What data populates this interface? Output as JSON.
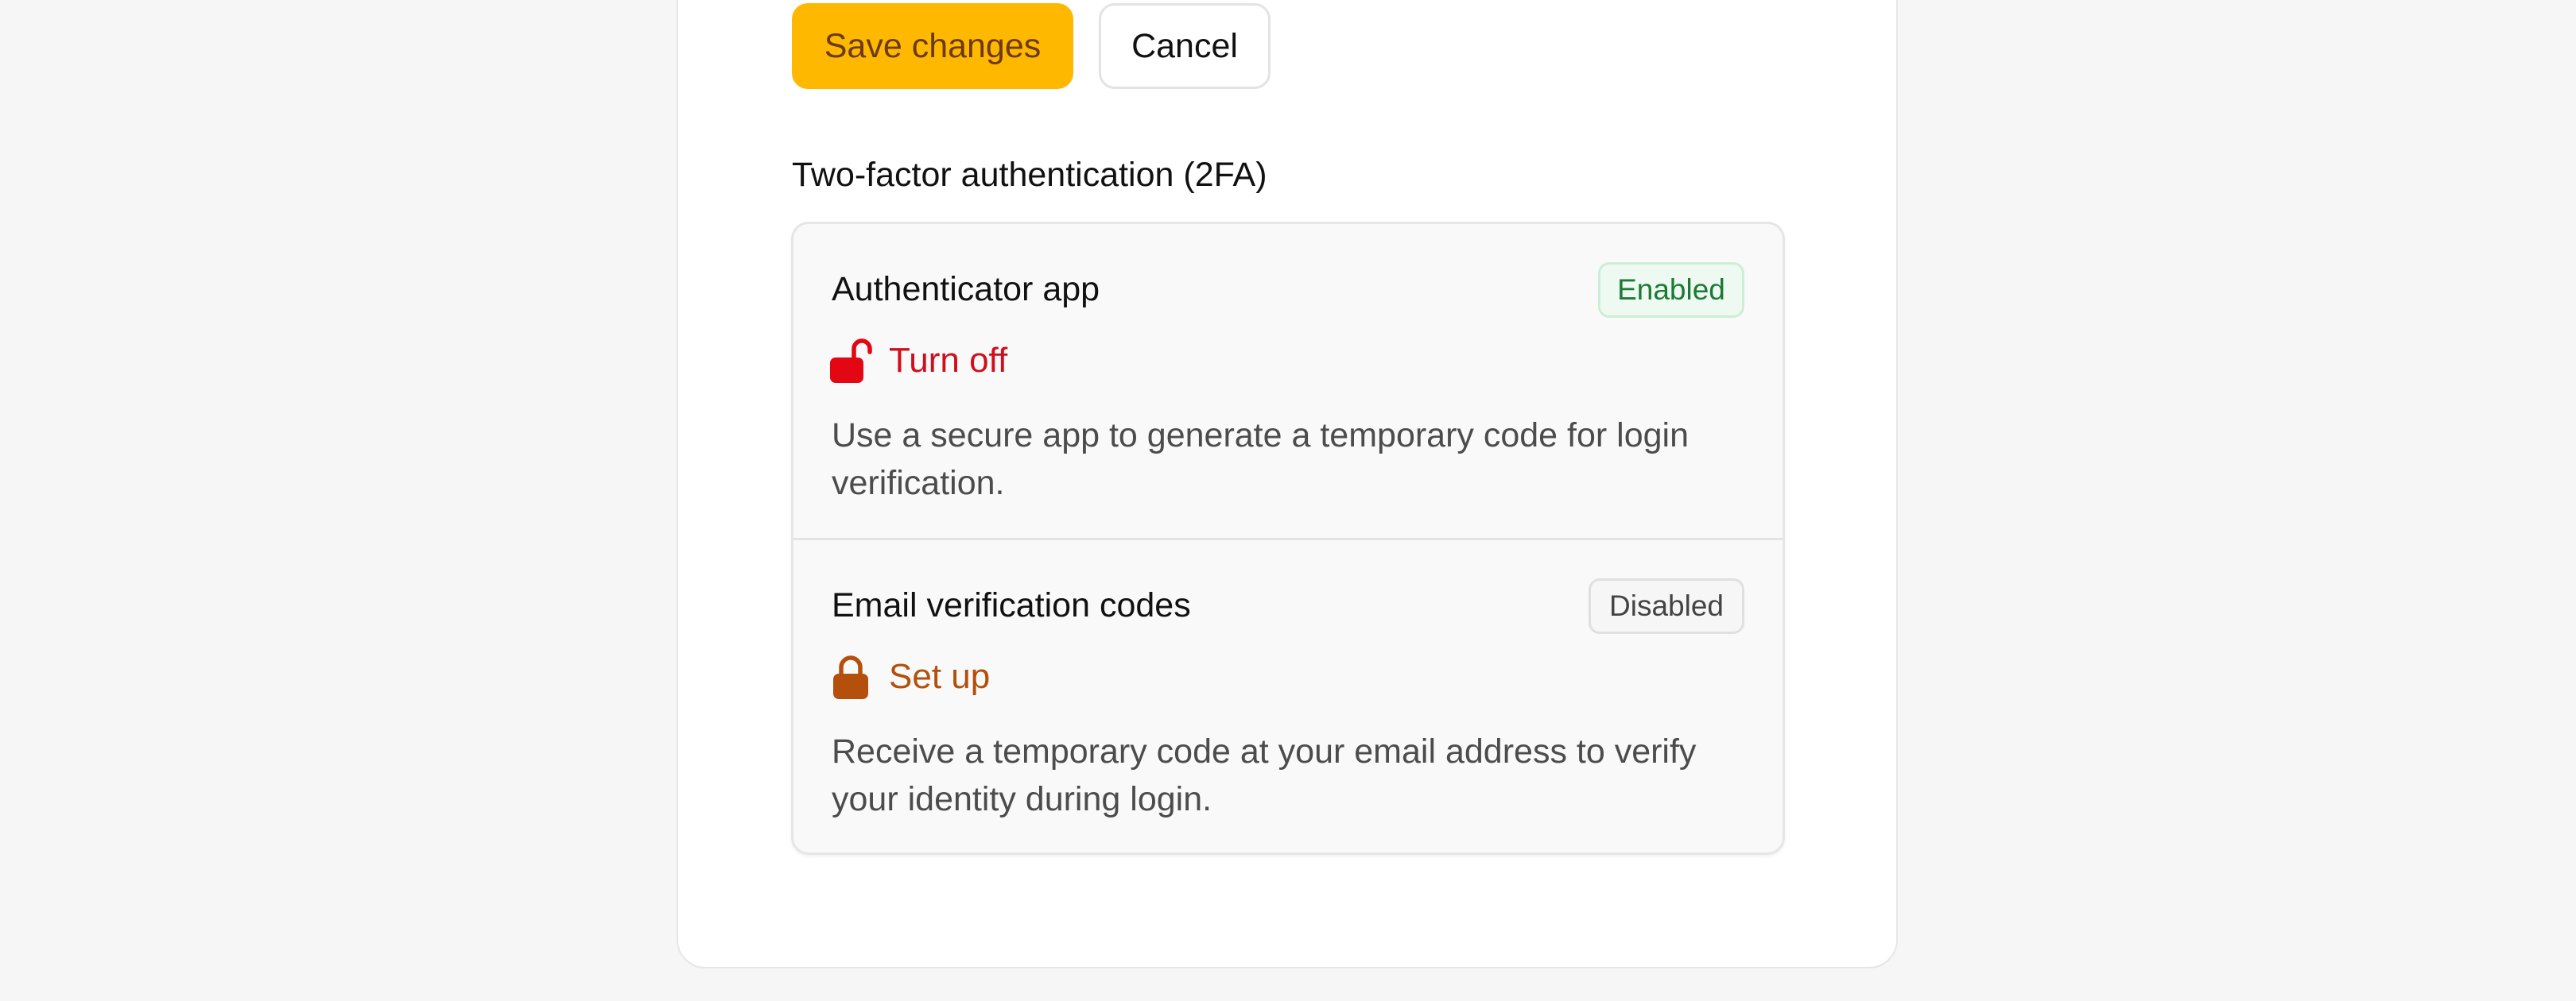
{
  "actions": {
    "save_label": "Save changes",
    "cancel_label": "Cancel"
  },
  "two_factor": {
    "title": "Two-factor authentication (2FA)",
    "methods": [
      {
        "name": "Authenticator app",
        "status": "Enabled",
        "action_label": "Turn off",
        "action_icon": "lock-open-icon",
        "description": "Use a secure app to generate a temporary code for login verification."
      },
      {
        "name": "Email verification codes",
        "status": "Disabled",
        "action_label": "Set up",
        "action_icon": "lock-closed-icon",
        "description": "Receive a temporary code at your email address to verify your identity during login."
      }
    ]
  },
  "colors": {
    "primary_button": "#ffb800",
    "enabled_text": "#1b7a33",
    "turn_off_text": "#d00f1c",
    "set_up_text": "#b4500c"
  }
}
